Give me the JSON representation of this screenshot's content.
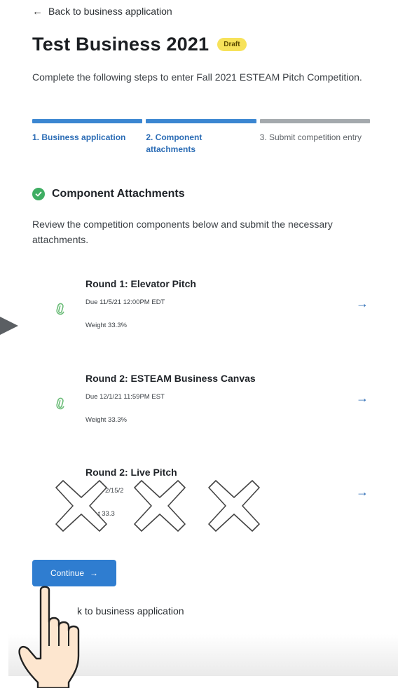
{
  "header": {
    "back_label": "Back to business application",
    "title": "Test Business 2021",
    "badge": "Draft",
    "intro": "Complete the following steps to enter Fall 2021 ESTEAM Pitch Competition."
  },
  "steps": [
    {
      "label": "1. Business application",
      "state": "complete"
    },
    {
      "label": "2. Component attachments",
      "state": "current"
    },
    {
      "label": "3. Submit competition entry",
      "state": "upcoming"
    }
  ],
  "section": {
    "title": "Component Attachments",
    "description": "Review the competition components below and submit the necessary attachments."
  },
  "components": [
    {
      "name": "Round 1: Elevator Pitch",
      "due": "Due 11/5/21 12:00PM EDT",
      "weight": "Weight 33.3%"
    },
    {
      "name": "Round 2: ESTEAM Business Canvas",
      "due": "Due 12/1/21 11:59PM EST",
      "weight": "Weight 33.3%"
    },
    {
      "name": "Round 2: Live Pitch",
      "due": "2/15/2",
      "weight": "t 33.3"
    }
  ],
  "continue_label": "Continue",
  "bottom_back_label": "k to business application",
  "colors": {
    "accent": "#2f7dd0",
    "badge": "#f7e25a",
    "check": "#3fae63",
    "progress_complete": "#3b86d1",
    "progress_upcoming": "#a4a9ad"
  },
  "icons": {
    "back": "arrow-left-icon",
    "section": "check-circle-icon",
    "attachment": "paperclip-icon",
    "open": "arrow-right-icon"
  }
}
